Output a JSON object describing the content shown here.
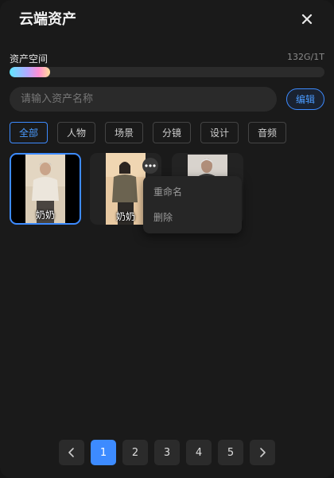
{
  "header": {
    "title": "云端资产"
  },
  "storage": {
    "label": "资产空间",
    "value": "132G/1T",
    "used_fraction": 0.129
  },
  "search": {
    "placeholder": "请输入资产名称"
  },
  "toolbar": {
    "edit_label": "编辑"
  },
  "tabs": [
    {
      "label": "全部",
      "active": true
    },
    {
      "label": "人物"
    },
    {
      "label": "场景"
    },
    {
      "label": "分镜"
    },
    {
      "label": "设计"
    },
    {
      "label": "音频"
    }
  ],
  "assets": [
    {
      "label": "奶奶",
      "selected": true
    },
    {
      "label": "奶奶"
    },
    {
      "label": ""
    }
  ],
  "context_menu": {
    "items": [
      {
        "label": "重命名"
      },
      {
        "label": "删除"
      }
    ]
  },
  "pagination": {
    "pages": [
      "1",
      "2",
      "3",
      "4",
      "5"
    ],
    "current": "1"
  },
  "colors": {
    "accent": "#3d8bff",
    "background": "#1a1a1a"
  }
}
